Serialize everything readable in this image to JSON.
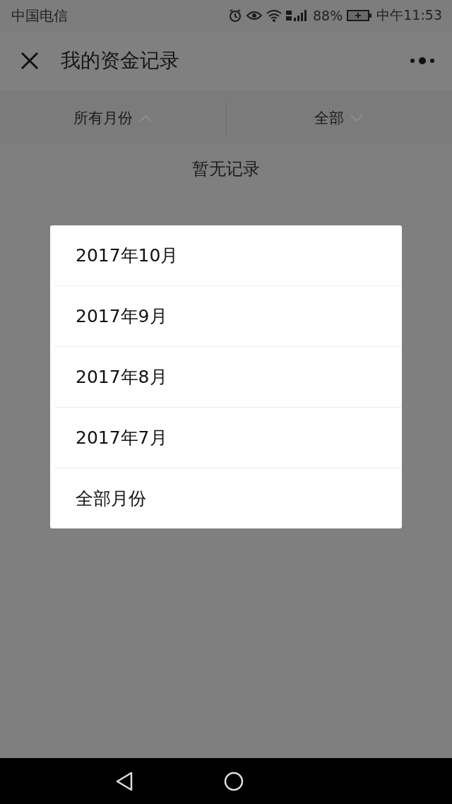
{
  "status_bar": {
    "carrier": "中国电信",
    "battery": "88%",
    "time": "中午11:53"
  },
  "header": {
    "title": "我的资金记录"
  },
  "filters": [
    {
      "label": "所有月份",
      "expanded": true
    },
    {
      "label": "全部",
      "expanded": false
    }
  ],
  "empty_message": "暂无记录",
  "month_menu": [
    "2017年10月",
    "2017年9月",
    "2017年8月",
    "2017年7月",
    "全部月份"
  ]
}
